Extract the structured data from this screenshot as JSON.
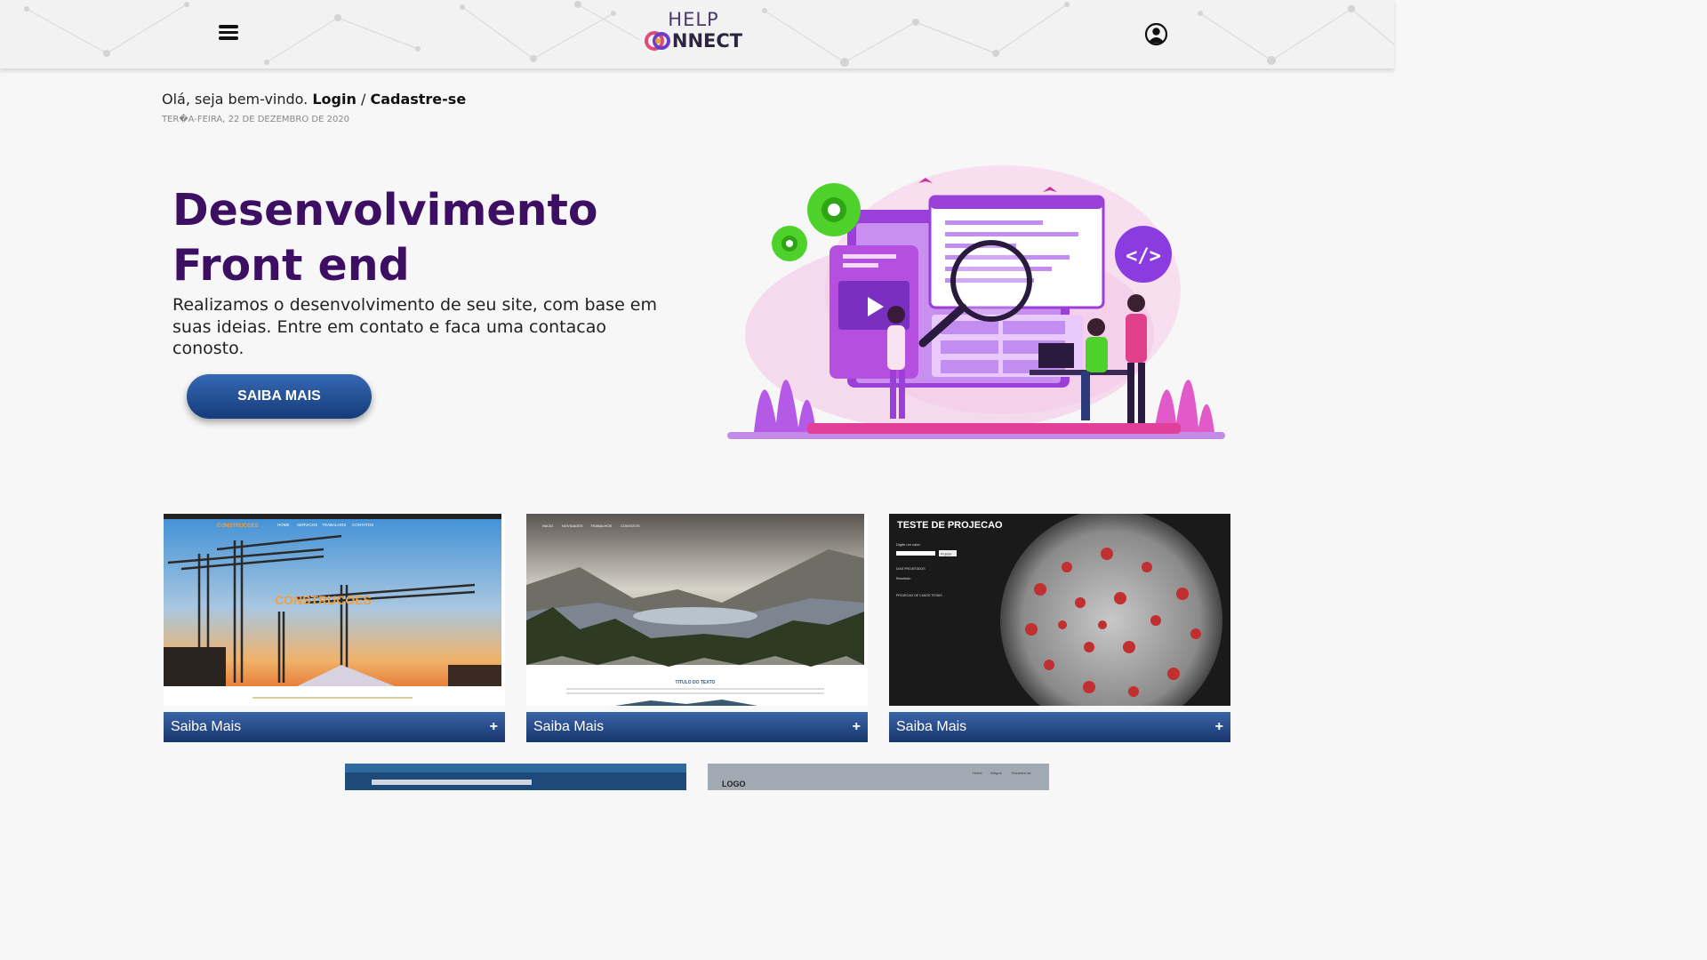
{
  "header": {
    "logo_top": "HELP",
    "logo_bottom": "NNECT",
    "menu_icon": "hamburger-menu-icon",
    "user_icon": "user-account-icon"
  },
  "welcome": {
    "greeting": "Olá, seja bem-vindo.",
    "login": "Login",
    "separator": "/",
    "signup": "Cadastre-se",
    "date": "TER�A-FEIRA, 22 DE DEZEMBRO DE 2020"
  },
  "hero": {
    "title_line1": "Desenvolvimento",
    "title_line2": "Front end",
    "text": "Realizamos o desenvolvimento de seu site, com base em suas ideias. Entre em contato e faca uma contacao conosto.",
    "cta": "SAIBA MAIS",
    "code_badge": "</>"
  },
  "cards": [
    {
      "label": "Saiba Mais",
      "plus": "+",
      "thumb_brand": "CONSTRUCOES",
      "thumb_title": "CONSTRUCOES",
      "thumb_nav": [
        "HOME",
        "SERVICOS",
        "TRABALHOS",
        "CONTATOS"
      ]
    },
    {
      "label": "Saiba Mais",
      "plus": "+",
      "thumb_nav": [
        "INICIO",
        "NOVIDADES",
        "TRABALHOS",
        "CONTATOS"
      ],
      "thumb_title": "TITULO DO TEXTO"
    },
    {
      "label": "Saiba Mais",
      "plus": "+",
      "thumb_title": "TESTE DE PROJECAO",
      "thumb_input_label": "Digite um valor:",
      "thumb_button": "Projetar",
      "thumb_line1": "DIAS PROJETADOS",
      "thumb_line2": "Resultado:",
      "thumb_line3": "PROJECAO DE CASOS TOTAIS"
    }
  ],
  "bottom_cards": [
    {
      "thumb_text": ""
    },
    {
      "thumb_text": "LOGO",
      "thumb_nav": [
        "Home",
        "Artigos",
        "Encontre-se"
      ]
    }
  ],
  "colors": {
    "accent_purple": "#3c0f63",
    "button_blue": "#1f4c92",
    "bar_blue": "#25498a"
  }
}
